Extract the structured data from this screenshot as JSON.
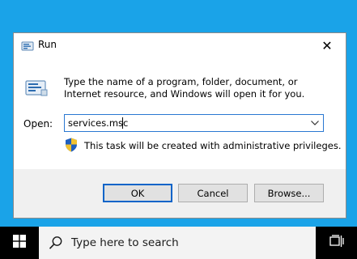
{
  "dialog": {
    "title": "Run",
    "close_glyph": "✕",
    "icon": "run-icon",
    "description": "Type the name of a program, folder, document, or Internet resource, and Windows will open it for you.",
    "open_label": "Open:",
    "input_value": "services.msc",
    "admin_note": "This task will be created with administrative privileges.",
    "buttons": {
      "ok": "OK",
      "cancel": "Cancel",
      "browse": "Browse..."
    },
    "colors": {
      "focus_border": "#2a78d2",
      "footer_bg": "#f0f0f0"
    }
  },
  "taskbar": {
    "search_placeholder": "Type here to search",
    "start_icon": "windows-logo-icon",
    "taskview_icon": "task-view-icon"
  },
  "desktop": {
    "background": "#1aa3e8"
  }
}
